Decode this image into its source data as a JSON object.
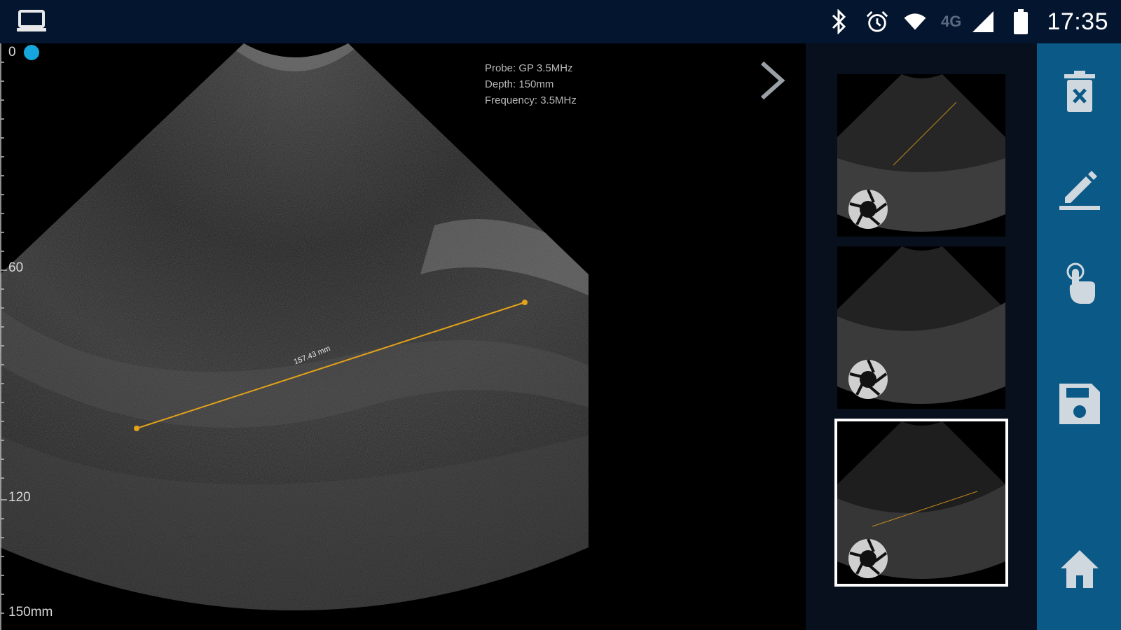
{
  "status_bar": {
    "left_icon": "laptop-icon",
    "icons": [
      "bluetooth-icon",
      "alarm-icon",
      "wifi-icon",
      "cell-signal-icon",
      "battery-icon"
    ],
    "network": "4G",
    "time": "17:35"
  },
  "viewer": {
    "depth_scale": {
      "top": "0",
      "mid": "60",
      "lower": "120",
      "bottom": "150mm"
    },
    "probe_info": {
      "probe": "Probe:  GP 3.5MHz",
      "depth": "Depth:  150mm",
      "frequency": "Frequency:  3.5MHz"
    },
    "measurement_label": "157.43 mm",
    "gain_indicator_color": "#16a6dd",
    "measurement_color": "#e3a21a"
  },
  "thumbnails": [
    {
      "name": "capture-1",
      "selected": false
    },
    {
      "name": "capture-2",
      "selected": false
    },
    {
      "name": "capture-3",
      "selected": true
    }
  ],
  "toolbar": {
    "icons": [
      "delete-icon",
      "edit-icon",
      "touch-icon",
      "save-icon",
      "home-icon"
    ],
    "background": "#0b5986"
  }
}
